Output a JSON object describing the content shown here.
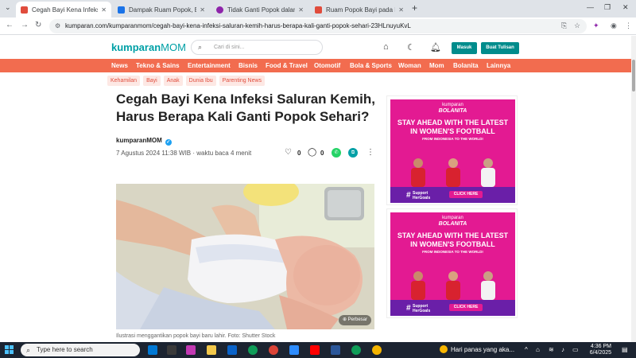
{
  "browser": {
    "tabs": [
      {
        "title": "Cegah Bayi Kena Infeksi Saluran",
        "active": true,
        "favicon_color": "#e04c3c"
      },
      {
        "title": "Dampak Ruam Popok, Bisa Han",
        "active": false,
        "favicon_color": "#1a73e8"
      },
      {
        "title": "Tidak Ganti Popok dalam Wakt",
        "active": false,
        "favicon_color": "#8e24aa"
      },
      {
        "title": "Ruam Popok Bayi pada Musim",
        "active": false,
        "favicon_color": "#e04c3c"
      }
    ],
    "new_tab_label": "+",
    "url": "kumparan.com/kumparanmom/cegah-bayi-kena-infeksi-saluran-kemih-harus-berapa-kali-ganti-popok-sehari-23HLnuyuKvL"
  },
  "site": {
    "logo_main": "kumparan",
    "logo_sub": "MOM",
    "search_placeholder": "Cari di sini...",
    "login_label": "Masuk",
    "write_label": "Buat Tulisan",
    "brand_color": "#00a0a6",
    "categories": [
      "News",
      "Tekno & Sains",
      "Entertainment",
      "Bisnis",
      "Food & Travel",
      "Otomotif",
      "Bola & Sports",
      "Woman",
      "Mom",
      "Bolanita",
      "Lainnya"
    ],
    "subcategories": [
      "Kehamilan",
      "Bayi",
      "Anak",
      "Dunia Ibu",
      "Parenting News"
    ]
  },
  "article": {
    "title": "Cegah Bayi Kena Infeksi Saluran Kemih, Harus Berapa Kali Ganti Popok Sehari?",
    "author": "kumparanMOM",
    "date": "7 Agustus 2024 11:38 WIB",
    "read_time": "· waktu baca 4 menit",
    "likes": "0",
    "comments": "0",
    "photo_button": "Perbesar",
    "caption": "Ilustrasi menggantikan popok bayi baru lahir. Foto: Shutter Stock"
  },
  "ads": [
    {
      "brand_top": "kumparan",
      "brand_bottom": "BOLANITA",
      "headline": "STAY AHEAD WITH THE LATEST IN WOMEN'S FOOTBALL",
      "subline": "FROM INDONESIA TO THE WORLD!",
      "hashtag": "#",
      "tag_line1": "Support",
      "tag_line2": "HerGoals",
      "cta": "CLICK HERE"
    },
    {
      "brand_top": "kumparan",
      "brand_bottom": "BOLANITA",
      "headline": "STAY AHEAD WITH THE LATEST IN WOMEN'S FOOTBALL",
      "subline": "FROM INDONESIA TO THE WORLD!",
      "hashtag": "#",
      "tag_line1": "Support",
      "tag_line2": "HerGoals",
      "cta": "CLICK HERE"
    }
  ],
  "taskbar": {
    "search_placeholder": "Type here to search",
    "weather_text": "Hari panas yang aka...",
    "time": "4:36 PM",
    "date": "6/4/2025"
  }
}
